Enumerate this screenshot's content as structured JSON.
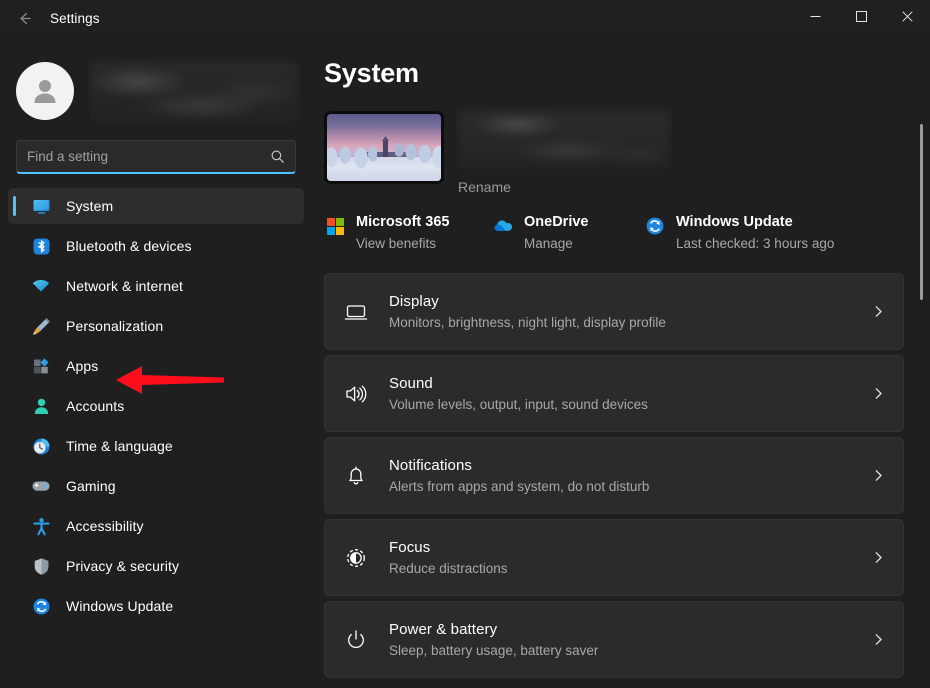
{
  "window": {
    "title": "Settings",
    "back_icon": "back-arrow-icon",
    "minimize_label": "—",
    "maximize_label": "□",
    "close_label": "✕"
  },
  "sidebar": {
    "account": {
      "avatar_icon": "person-avatar-icon",
      "name_redacted": true
    },
    "search": {
      "placeholder": "Find a setting",
      "value": "",
      "icon": "search-icon"
    },
    "items": [
      {
        "label": "System",
        "icon": "monitor-icon",
        "active": true
      },
      {
        "label": "Bluetooth & devices",
        "icon": "bluetooth-icon",
        "active": false
      },
      {
        "label": "Network & internet",
        "icon": "wifi-icon",
        "active": false
      },
      {
        "label": "Personalization",
        "icon": "paintbrush-icon",
        "active": false
      },
      {
        "label": "Apps",
        "icon": "apps-icon",
        "active": false
      },
      {
        "label": "Accounts",
        "icon": "person-icon",
        "active": false
      },
      {
        "label": "Time & language",
        "icon": "clock-globe-icon",
        "active": false
      },
      {
        "label": "Gaming",
        "icon": "gamepad-icon",
        "active": false
      },
      {
        "label": "Accessibility",
        "icon": "accessibility-icon",
        "active": false
      },
      {
        "label": "Privacy & security",
        "icon": "shield-icon",
        "active": false
      },
      {
        "label": "Windows Update",
        "icon": "update-refresh-icon",
        "active": false
      }
    ]
  },
  "main": {
    "page_title": "System",
    "device": {
      "thumbnail_icon": "desktop-wallpaper-thumbnail",
      "name_redacted": true,
      "rename_label": "Rename"
    },
    "quick_links": [
      {
        "title": "Microsoft 365",
        "subtitle": "View benefits",
        "icon": "microsoft-logo-icon"
      },
      {
        "title": "OneDrive",
        "subtitle": "Manage",
        "icon": "onedrive-cloud-icon"
      },
      {
        "title": "Windows Update",
        "subtitle": "Last checked: 3 hours ago",
        "icon": "update-refresh-icon"
      }
    ],
    "cards": [
      {
        "title": "Display",
        "subtitle": "Monitors, brightness, night light, display profile",
        "icon": "display-monitor-icon",
        "chevron": "chevron-right-icon"
      },
      {
        "title": "Sound",
        "subtitle": "Volume levels, output, input, sound devices",
        "icon": "sound-speaker-icon",
        "chevron": "chevron-right-icon"
      },
      {
        "title": "Notifications",
        "subtitle": "Alerts from apps and system, do not disturb",
        "icon": "notification-bell-icon",
        "chevron": "chevron-right-icon"
      },
      {
        "title": "Focus",
        "subtitle": "Reduce distractions",
        "icon": "focus-icon",
        "chevron": "chevron-right-icon"
      },
      {
        "title": "Power & battery",
        "subtitle": "Sleep, battery usage, battery saver",
        "icon": "power-icon",
        "chevron": "chevron-right-icon"
      }
    ]
  },
  "annotation": {
    "arrow_color": "#fc0d1b",
    "points_to": "Apps"
  },
  "colors": {
    "accent": "#4cc2ff",
    "page_background": "#1f1f1f",
    "card_background": "#2b2b2b",
    "titlebar_background": "#202020",
    "text_primary": "#ffffff",
    "text_secondary": "#a8a8a8"
  },
  "scrollbar": {
    "visible": true
  }
}
